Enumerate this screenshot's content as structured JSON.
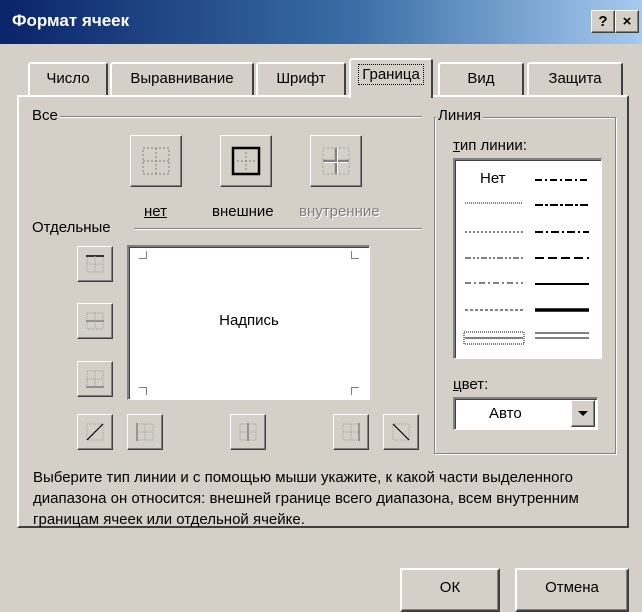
{
  "window": {
    "title": "Формат ячеек",
    "help_glyph": "?",
    "close_glyph": "×"
  },
  "tabs": [
    {
      "label": "Число"
    },
    {
      "label": "Выравнивание"
    },
    {
      "label": "Шрифт"
    },
    {
      "label": "Граница",
      "active": true
    },
    {
      "label": "Вид"
    },
    {
      "label": "Защита"
    }
  ],
  "presets": {
    "group_label": "Все",
    "none_label": "нет",
    "outline_label": "внешние",
    "inside_label": "внутренние"
  },
  "borders": {
    "group_label": "Отдельные",
    "preview_text": "Надпись"
  },
  "line": {
    "group_label": "Линия",
    "style_label": "тип линии:",
    "none_style": "Нет",
    "color_label": "цвет:",
    "color_value": "Авто"
  },
  "help_text": "Выберите тип линии и с помощью мыши укажите, к какой части выделенного диапазона он относится: внешней границе всего диапазона, всем внутренним границам ячеек или отдельной ячейке.",
  "buttons": {
    "ok": "ОК",
    "cancel": "Отмена"
  },
  "colors": {
    "face": "#d4d0c8",
    "title_start": "#0a246a",
    "title_end": "#a6caf0",
    "disabled_text": "#808080"
  }
}
